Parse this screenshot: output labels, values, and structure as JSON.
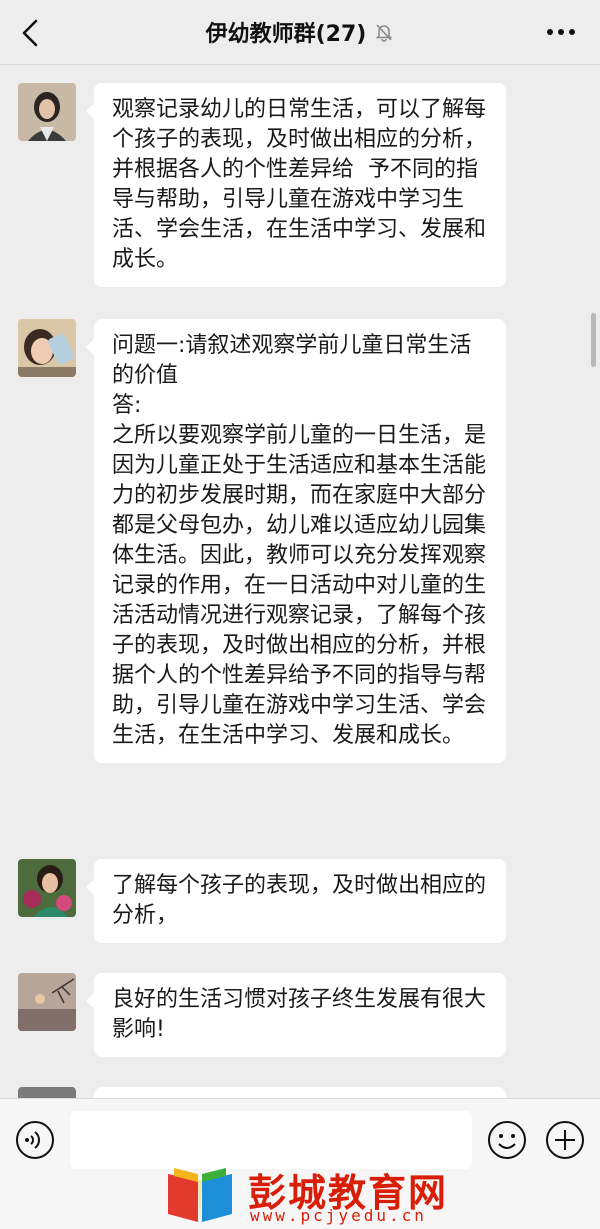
{
  "header": {
    "title": "伊幼教师群(27)",
    "back_icon": "chevron-left-icon",
    "mute_icon": "bell-off-icon",
    "more_icon": "more-dots-icon"
  },
  "messages": [
    {
      "avatar": "avatar-girl",
      "text": "观察记录幼儿的日常生活，可以了解每个孩子的表现，及时做出相应的分析，并根据各人的个性差异给  予不同的指导与帮助，引导儿童在游戏中学习生活、学会生活，在生活中学习、发展和  成长。"
    },
    {
      "avatar": "avatar-child-drinking",
      "text": "问题一:请叙述观察学前儿童日常生活的价值\n答:\n之所以要观察学前儿童的一日生活，是因为儿童正处于生活适应和基本生活能力的初步发展时期，而在家庭中大部分都是父母包办，幼儿难以适应幼儿园集体生活。因此，教师可以充分发挥观察记录的作用，在一日活动中对儿童的生活活动情况进行观察记录，了解每个孩子的表现，及时做出相应的分析，并根据个人的个性差异给予不同的指导与帮助，引导儿童在游戏中学习生活、学会生活，在生活中学习、发展和成长。"
    },
    {
      "avatar": "avatar-woman-flowers",
      "text": "了解每个孩子的表现，及时做出相应的分析，"
    },
    {
      "avatar": "avatar-sunset",
      "text": "良好的生活习惯对孩子终生发展有很大影响!"
    }
  ],
  "input_bar": {
    "voice_icon": "voice-icon",
    "emoji_icon": "emoji-icon",
    "plus_icon": "plus-circle-icon",
    "value": ""
  },
  "watermark": {
    "title": "彭城教育网",
    "url": "www.pcjyedu.cn"
  },
  "colors": {
    "background": "#ededed",
    "bubble": "#ffffff",
    "watermark": "#d81e06"
  }
}
